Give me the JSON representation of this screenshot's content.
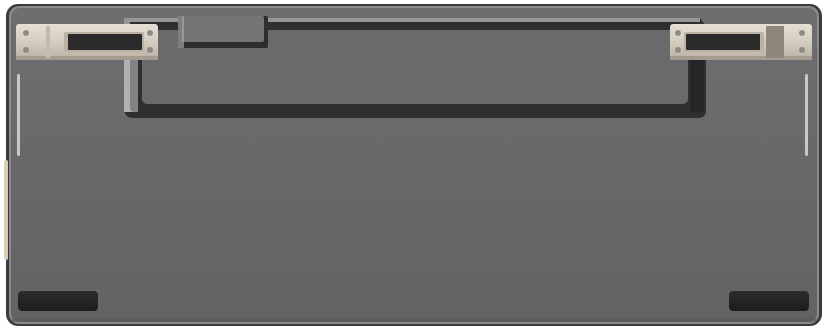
{
  "image": {
    "subject": "keyboard-underside",
    "colors": {
      "background": "#ffffff",
      "body": "#68686a",
      "body_edge": "#3a3a3c",
      "frame_highlight": "#9a9a9c",
      "kickstand_dark": "#2e2e30",
      "kickstand_highlight": "#b8b8ba",
      "hinge_metal": "#d8d2c6",
      "hinge_metal_shadow": "#a39c8f",
      "hinge_slot": "#2a2a2b",
      "screw": "#9a9590",
      "rubber_foot": "#222224",
      "light_bar": "#c9c9cb",
      "side_accent": "#d9cdb8"
    }
  }
}
